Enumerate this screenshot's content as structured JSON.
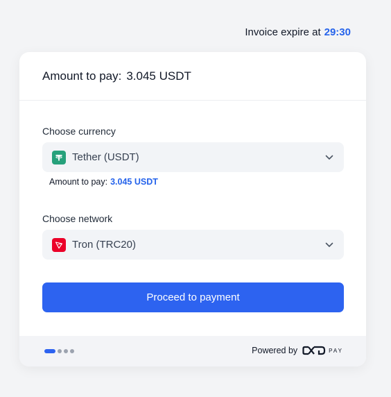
{
  "invoice": {
    "expire_label": "Invoice expire at",
    "timer": "29:30"
  },
  "header": {
    "label": "Amount to pay:",
    "amount": "3.045 USDT"
  },
  "currency": {
    "label": "Choose currency",
    "selected": "Tether (USDT)",
    "icon": "tether-icon",
    "icon_color": "#26a17b",
    "amount_label": "Amount to pay:",
    "amount_value": "3.045 USDT"
  },
  "network": {
    "label": "Choose network",
    "selected": "Tron (TRC20)",
    "icon": "tron-icon",
    "icon_color": "#eb0029"
  },
  "proceed_label": "Proceed to payment",
  "footer": {
    "powered_label": "Powered by",
    "brand_text": "PAY",
    "steps_total": 4,
    "step_active": 1
  },
  "colors": {
    "accent": "#2d63f0",
    "link": "#2563eb",
    "background": "#f3f4f6"
  }
}
